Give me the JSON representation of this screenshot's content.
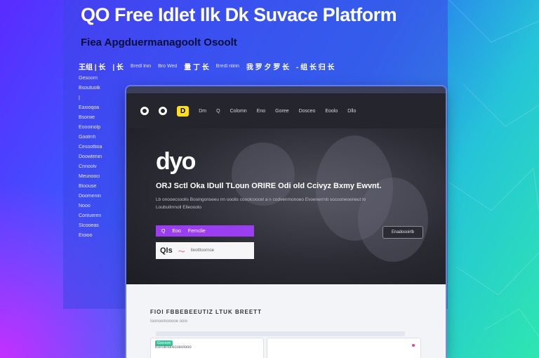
{
  "hero": {
    "title": "QO Free Idlet Ilk Dk Suvace Platform",
    "subtitle": "Fiea Apgduermanagoolt Osoolt"
  },
  "nav_strip": [
    {
      "label": "王组 | 长",
      "small": false
    },
    {
      "label": "| 长",
      "small": false
    },
    {
      "label": "Bredl lnin",
      "small": true
    },
    {
      "label": "Bro Wed",
      "small": true
    },
    {
      "label": "量 丁 长",
      "small": false
    },
    {
      "label": "Bredl nlirin",
      "small": true
    },
    {
      "label": "我 罗 夕 罗 长",
      "small": false
    },
    {
      "label": "- 组 长 归 长",
      "small": false
    }
  ],
  "sidelist": [
    "Gesoorn",
    "Bsoutuolk",
    "|",
    "Eaxioqoa",
    "Bsoniie",
    "Eoooinolp",
    "Goolmh",
    "Cesoottioa",
    "Doowtenin",
    "Cnnoolv",
    "Meunooci",
    "Bloouse",
    "Doomenin",
    "Nooo",
    "Conlueren",
    "Slcooeas",
    "Eioioo"
  ],
  "window": {
    "nav": {
      "badge": "D",
      "links": [
        "Dm",
        "Q",
        "Colomn",
        "Eno",
        "Goree",
        "Dosceo",
        "Eoolo",
        "Dllo"
      ]
    },
    "brand": "dyo",
    "tagline": "ORJ Sctl Oka IDuIl TLoun ORIRE Odi old Ccivyz Bxmy Ewvnt.",
    "description": "Lb onooecsoolis  Bosingonseeu nn ooolis cooolcoocel a n codvenmonoeo  Evoenerrnti  socooneoeneut lo Loubuilmnoll  Elleooolo",
    "cta_primary": {
      "icon": "Q",
      "text1": "Eoo",
      "text2": "Fernclie"
    },
    "cta_secondary": {
      "mark": "QIs",
      "text": "Ileotttoornoe"
    },
    "cta_ghost": "Enadoooirlb",
    "section_title": "FIOI FBBEBEEUTIZ LTUK BREETT",
    "section_sub": "Ioonoomooooe     ooio",
    "cards": [
      {
        "chip": "Gocoore",
        "label": "Eorolinorecoeolooo"
      },
      {
        "chip": "",
        "label": ""
      }
    ]
  },
  "colors": {
    "accent_purple": "#9b3df0",
    "logo_yellow": "#ffe01b",
    "hero_dark": "#24252d"
  }
}
